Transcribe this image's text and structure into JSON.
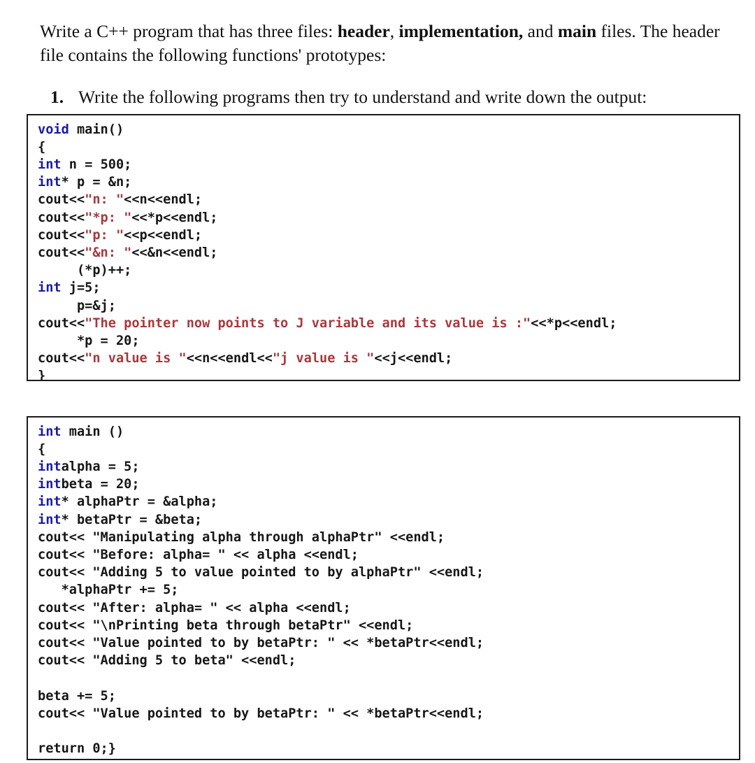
{
  "document": {
    "intro": {
      "segments": [
        {
          "text": "Write a C++ program that has three files: ",
          "bold": false
        },
        {
          "text": "header",
          "bold": true
        },
        {
          "text": ", ",
          "bold": false
        },
        {
          "text": "implementation,",
          "bold": true
        },
        {
          "text": " and ",
          "bold": false
        },
        {
          "text": "main",
          "bold": true
        },
        {
          "text": " files. The header file contains the following functions' prototypes:",
          "bold": false
        }
      ],
      "plain_text": "Write a C++ program that has three files: header, implementation, and main files. The header file contains the following functions' prototypes:"
    },
    "question": {
      "number": "1.",
      "text": "Write the following programs then try to understand and write down the output:"
    },
    "code_blocks": [
      {
        "id": "code-block-1",
        "language": "cpp",
        "plain_text": "void main()\n{\nint n = 500;\nint* p = &n;\ncout<<\"n: \"<<n<<endl;\ncout<<\"*p: \"<<*p<<endl;\ncout<<\"p: \"<<p<<endl;\ncout<<\"&n: \"<<&n<<endl;\n     (*p)++;\nint j=5;\n     p=&j;\ncout<<\"The pointer now points to J variable and its value is :\"<<*p<<endl;\n     *p = 20;\ncout<<\"n value is \"<<n<<endl<<\"j value is \"<<j<<endl;\n}",
        "lines": [
          [
            {
              "t": "void",
              "c": "kw"
            },
            {
              "t": " main()",
              "c": "blk"
            }
          ],
          [
            {
              "t": "{",
              "c": "blk"
            }
          ],
          [
            {
              "t": "int",
              "c": "kw"
            },
            {
              "t": " n = 500;",
              "c": "blk"
            }
          ],
          [
            {
              "t": "int",
              "c": "kw"
            },
            {
              "t": "* p = &n;",
              "c": "blk"
            }
          ],
          [
            {
              "t": "cout<<",
              "c": "blk"
            },
            {
              "t": "\"n: \"",
              "c": "str"
            },
            {
              "t": "<<n<<endl;",
              "c": "blk"
            }
          ],
          [
            {
              "t": "cout<<",
              "c": "blk"
            },
            {
              "t": "\"*p: \"",
              "c": "str"
            },
            {
              "t": "<<*p<<endl;",
              "c": "blk"
            }
          ],
          [
            {
              "t": "cout<<",
              "c": "blk"
            },
            {
              "t": "\"p: \"",
              "c": "str"
            },
            {
              "t": "<<p<<endl;",
              "c": "blk"
            }
          ],
          [
            {
              "t": "cout<<",
              "c": "blk"
            },
            {
              "t": "\"&n: \"",
              "c": "str"
            },
            {
              "t": "<<&n<<endl;",
              "c": "blk"
            }
          ],
          [
            {
              "t": "     (*p)++;",
              "c": "blk"
            }
          ],
          [
            {
              "t": "int",
              "c": "kw"
            },
            {
              "t": " j=5;",
              "c": "blk"
            }
          ],
          [
            {
              "t": "     p=&j;",
              "c": "blk"
            }
          ],
          [
            {
              "t": "cout<<",
              "c": "blk"
            },
            {
              "t": "\"The pointer now points to J variable and its value is :\"",
              "c": "str"
            },
            {
              "t": "<<*p<<endl;",
              "c": "blk"
            }
          ],
          [
            {
              "t": "     *p = 20;",
              "c": "blk"
            }
          ],
          [
            {
              "t": "cout<<",
              "c": "blk"
            },
            {
              "t": "\"n value is \"",
              "c": "str"
            },
            {
              "t": "<<n<<endl<<",
              "c": "blk"
            },
            {
              "t": "\"j value is \"",
              "c": "str"
            },
            {
              "t": "<<j<<endl;",
              "c": "blk"
            }
          ],
          [
            {
              "t": "}",
              "c": "blk"
            }
          ]
        ]
      },
      {
        "id": "code-block-2",
        "language": "cpp",
        "plain_text": "int main ()\n{\nintalpha = 5;\nintbeta = 20;\nint* alphaPtr = &alpha;\nint* betaPtr = &beta;\ncout<< \"Manipulating alpha through alphaPtr\" <<endl;\ncout<< \"Before: alpha= \" << alpha <<endl;\ncout<< \"Adding 5 to value pointed to by alphaPtr\" <<endl;\n   *alphaPtr += 5;\ncout<< \"After: alpha= \" << alpha <<endl;\ncout<< \"\\nPrinting beta through betaPtr\" <<endl;\ncout<< \"Value pointed to by betaPtr: \" << *betaPtr<<endl;\ncout<< \"Adding 5 to beta\" <<endl;\n\nbeta += 5;\ncout<< \"Value pointed to by betaPtr: \" << *betaPtr<<endl;\n\nreturn 0;}",
        "lines": [
          [
            {
              "t": "int",
              "c": "kw"
            },
            {
              "t": " main ()",
              "c": "blk"
            }
          ],
          [
            {
              "t": "{",
              "c": "blk"
            }
          ],
          [
            {
              "t": "int",
              "c": "kw"
            },
            {
              "t": "alpha = 5;",
              "c": "blk"
            }
          ],
          [
            {
              "t": "int",
              "c": "kw"
            },
            {
              "t": "beta = 20;",
              "c": "blk"
            }
          ],
          [
            {
              "t": "int",
              "c": "kw"
            },
            {
              "t": "* alphaPtr = &alpha;",
              "c": "blk"
            }
          ],
          [
            {
              "t": "int",
              "c": "kw"
            },
            {
              "t": "* betaPtr = &beta;",
              "c": "blk"
            }
          ],
          [
            {
              "t": "cout<< \"Manipulating alpha through alphaPtr\" <<endl;",
              "c": "blk"
            }
          ],
          [
            {
              "t": "cout<< \"Before: alpha= \" << alpha <<endl;",
              "c": "blk"
            }
          ],
          [
            {
              "t": "cout<< \"Adding 5 to value pointed to by alphaPtr\" <<endl;",
              "c": "blk"
            }
          ],
          [
            {
              "t": "   *alphaPtr += 5;",
              "c": "blk"
            }
          ],
          [
            {
              "t": "cout<< \"After: alpha= \" << alpha <<endl;",
              "c": "blk"
            }
          ],
          [
            {
              "t": "cout<< \"\\nPrinting beta through betaPtr\" <<endl;",
              "c": "blk"
            }
          ],
          [
            {
              "t": "cout<< \"Value pointed to by betaPtr: \" << *betaPtr<<endl;",
              "c": "blk"
            }
          ],
          [
            {
              "t": "cout<< \"Adding 5 to beta\" <<endl;",
              "c": "blk"
            }
          ],
          [
            {
              "t": "",
              "c": "blk"
            }
          ],
          [
            {
              "t": "beta += 5;",
              "c": "blk"
            }
          ],
          [
            {
              "t": "cout<< \"Value pointed to by betaPtr: \" << *betaPtr<<endl;",
              "c": "blk"
            }
          ],
          [
            {
              "t": "",
              "c": "blk"
            }
          ],
          [
            {
              "t": "return 0;}",
              "c": "blk"
            }
          ]
        ]
      }
    ],
    "colors": {
      "keyword": "#1a1aa6",
      "string": "#a8383c",
      "code_text": "#161616",
      "border": "#1b1b1b",
      "background": "#ffffff",
      "prose_text": "#111111"
    }
  }
}
